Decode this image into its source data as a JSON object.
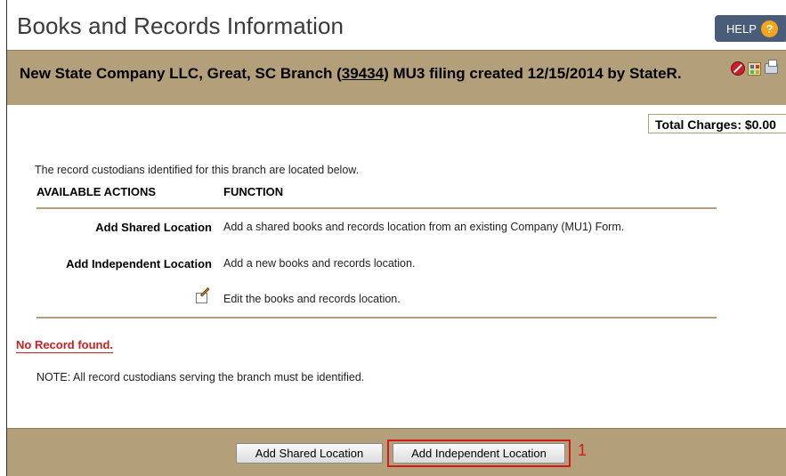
{
  "page": {
    "title": "Books and Records Information",
    "help_label": "HELP",
    "help_icon_glyph": "?"
  },
  "header": {
    "prefix": "New State Company LLC, Great, SC Branch (",
    "filing_id": "39434",
    "suffix": ") MU3 filing created 12/15/2014 by StateR.",
    "icons": [
      "cancel-icon",
      "grid-icon",
      "print-icon"
    ]
  },
  "charges": {
    "label": "Total Charges: $0.00"
  },
  "content": {
    "intro": "The record custodians identified for this branch are located below.",
    "table": {
      "headers": [
        "AVAILABLE ACTIONS",
        "FUNCTION"
      ],
      "rows": [
        {
          "action": "Add Shared Location",
          "function": "Add a shared books and records location from an existing Company (MU1) Form."
        },
        {
          "action": "Add Independent Location",
          "function": "Add a new books and records location."
        },
        {
          "action": "",
          "icon": "edit-icon",
          "function": "Edit the books and records location."
        }
      ]
    },
    "no_record": "No Record found.",
    "note": "NOTE: All record custodians serving the branch must be identified."
  },
  "footer": {
    "shared_button": "Add Shared Location",
    "independent_button": "Add Independent Location",
    "step_marker": "1"
  },
  "colors": {
    "band": "#b3a07a",
    "help_bg": "#4a5d78",
    "help_icon": "#f5a51b",
    "error": "#cc1f1f",
    "highlight": "#d11a1a"
  }
}
